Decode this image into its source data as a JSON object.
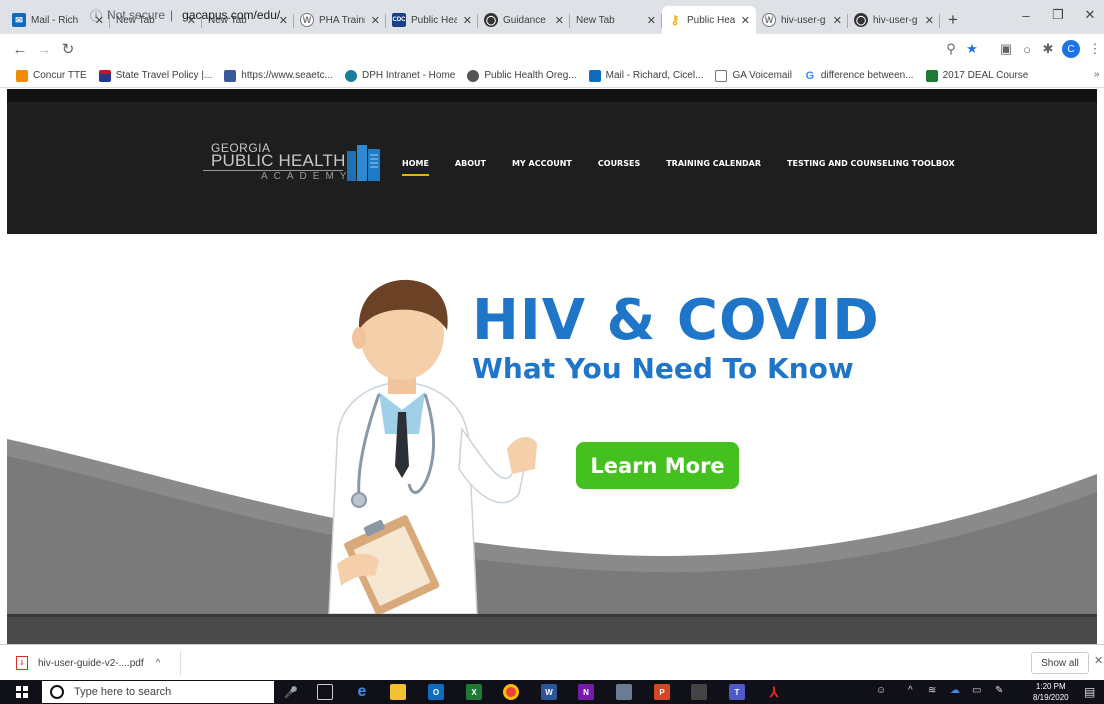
{
  "browser": {
    "tabs": [
      {
        "title": "Mail - Rich",
        "icon": "outlook-icon",
        "color": "#0f6cbd"
      },
      {
        "title": "New Tab",
        "icon": "blank-icon",
        "color": "#dee1e6"
      },
      {
        "title": "New Tab",
        "icon": "blank-icon",
        "color": "#dee1e6"
      },
      {
        "title": "PHA Trainin",
        "icon": "wordpress-icon",
        "color": "#777777"
      },
      {
        "title": "Public Hea",
        "icon": "cdc-icon",
        "color": "#1a3e8c"
      },
      {
        "title": "Guidance",
        "icon": "globe-icon",
        "color": "#333333"
      },
      {
        "title": "New Tab",
        "icon": "blank-icon",
        "color": "#dee1e6"
      },
      {
        "title": "Public Hea",
        "icon": "key-icon",
        "color": "#f0b400"
      },
      {
        "title": "hiv-user-g",
        "icon": "wordpress-icon",
        "color": "#777777"
      },
      {
        "title": "hiv-user-g",
        "icon": "globe-icon",
        "color": "#333333"
      }
    ],
    "new_tab_glyph": "+",
    "window_controls": {
      "minimize": "–",
      "restore": "❐",
      "close": "✕"
    },
    "omnibox": {
      "security": "Not secure",
      "separator": "|",
      "url": "gacapus.com/edu/"
    },
    "profile_initial": "C",
    "bookmarks": [
      {
        "label": "Concur TTE",
        "color": "#f08c00"
      },
      {
        "label": "State Travel Policy |...",
        "color": "#1e3a8a"
      },
      {
        "label": "https://www.seaetc...",
        "color": "#3b5998"
      },
      {
        "label": "DPH Intranet - Home",
        "color": "#1a7f9c"
      },
      {
        "label": "Public Health Oreg...",
        "color": "#555555"
      },
      {
        "label": "Mail - Richard, Cicel...",
        "color": "#0f6cbd"
      },
      {
        "label": "GA Voicemail",
        "color": "#777777"
      },
      {
        "label": "difference between...",
        "color": "#4285f4"
      },
      {
        "label": "2017 DEAL Course",
        "color": "#1e7b34"
      }
    ],
    "bookmarks_overflow": "»"
  },
  "site": {
    "logo": {
      "line1": "GEORGIA",
      "line2": "PUBLIC HEALTH",
      "line3": "ACADEMY"
    },
    "nav": [
      "HOME",
      "ABOUT",
      "MY ACCOUNT",
      "COURSES",
      "TRAINING CALENDAR",
      "TESTING AND COUNSELING TOOLBOX"
    ],
    "hero": {
      "headline": "HIV & COVID",
      "subheadline": "What You Need To Know",
      "cta": "Learn More"
    }
  },
  "downloads": {
    "file": "hiv-user-guide-v2-....pdf",
    "chevron": "^",
    "show_all": "Show all",
    "close": "✕"
  },
  "taskbar": {
    "search_placeholder": "Type here to search",
    "time": "1:20 PM",
    "date": "8/19/2020"
  },
  "colors": {
    "brand_blue": "#1f76c8",
    "cta_green": "#44c01f",
    "header_dark": "#1e1e1e",
    "nav_underline": "#e6b317"
  }
}
